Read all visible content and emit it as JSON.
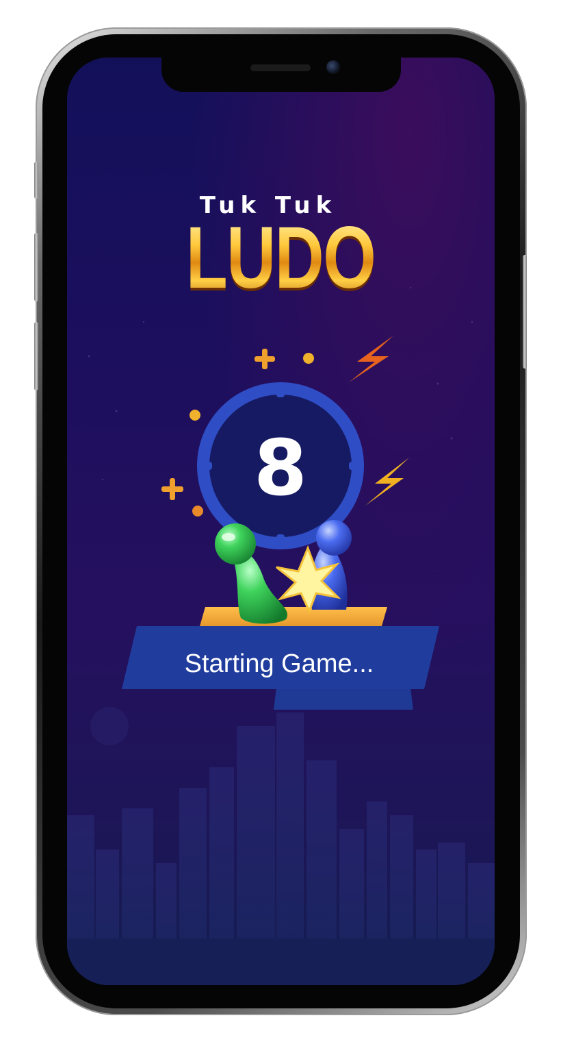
{
  "app": {
    "title_line1": "Tuk Tuk",
    "title_line2": "LUDO"
  },
  "timer": {
    "value": "8",
    "icon": "countdown-clock-icon"
  },
  "status": {
    "message": "Starting Game..."
  },
  "decorations": {
    "icons": [
      "plus-icon",
      "dot-icon",
      "lightning-bolt-icon",
      "ludo-pawn-green-icon",
      "ludo-pawn-blue-icon",
      "collision-spark-icon"
    ]
  },
  "colors": {
    "background_top": "#13105a",
    "background_bottom": "#141e52",
    "gold": "#f2a31e",
    "clock_ring": "#2f4dc4",
    "banner": "#203d9e",
    "pedestal": "#f0a02c",
    "pawn_green": "#2fb34a",
    "pawn_blue": "#3456d6"
  }
}
